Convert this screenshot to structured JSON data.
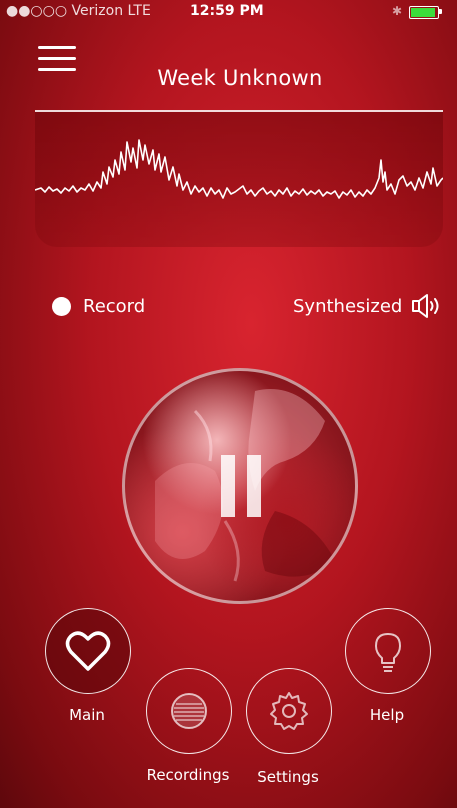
{
  "status_bar": {
    "carrier": "●●○○○ Verizon  LTE",
    "time": "12:59 PM",
    "bluetooth": "✱"
  },
  "header": {
    "title": "Week Unknown"
  },
  "controls": {
    "record_label": "Record",
    "synth_label": "Synthesized"
  },
  "nav": {
    "main_label": "Main",
    "recordings_label": "Recordings",
    "settings_label": "Settings",
    "help_label": "Help"
  },
  "icons": [
    "menu-icon",
    "speaker-icon",
    "pause-icon",
    "heart-icon",
    "recordings-icon",
    "gear-icon",
    "lightbulb-icon",
    "battery-icon",
    "bluetooth-icon"
  ],
  "colors": {
    "background": "#b3151f",
    "accent": "#ffffff",
    "battery": "#3bdc3b"
  }
}
